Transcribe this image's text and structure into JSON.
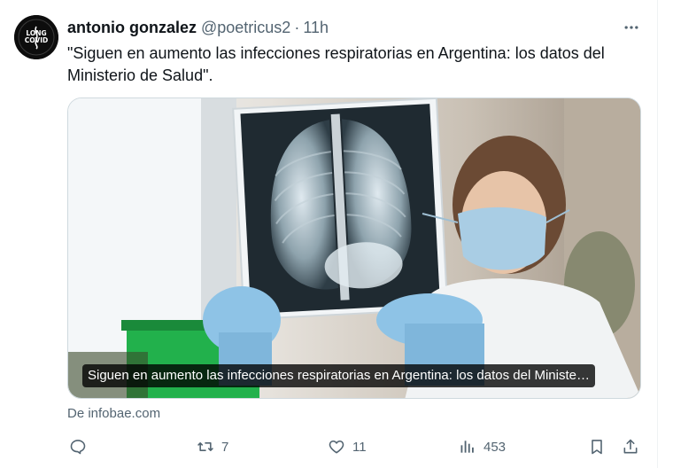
{
  "author": {
    "name": "antonio gonzalez",
    "handle": "@poetricus2",
    "separator": "·",
    "time": "11h",
    "avatar_text": [
      "LONG",
      "COVID"
    ]
  },
  "tweet": {
    "text": "\"Siguen en aumento las infecciones respiratorias en Argentina: los datos del Ministerio de Salud\"."
  },
  "card": {
    "caption": "Siguen en aumento las infecciones respiratorias en Argentina: los datos del Ministe…",
    "source": "De infobae.com"
  },
  "actions": {
    "replies": "",
    "retweets": "7",
    "likes": "11",
    "views": "453"
  },
  "icons": {
    "more": "more-icon",
    "reply": "reply-icon",
    "retweet": "retweet-icon",
    "like": "heart-icon",
    "views": "views-icon",
    "bookmark": "bookmark-icon",
    "share": "share-icon"
  },
  "colors": {
    "text": "#0f1419",
    "secondary": "#536471",
    "border": "#cfd9de"
  }
}
